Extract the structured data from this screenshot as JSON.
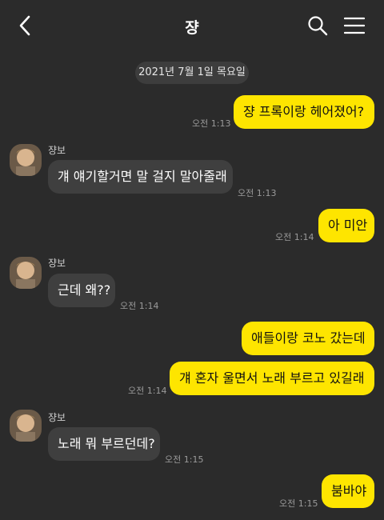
{
  "header": {
    "title": "쟝"
  },
  "date_divider": "2021년 7월 1일 목요일",
  "sender_name": "쟝보",
  "messages": [
    {
      "from": "me",
      "text": "쟝 프록이랑 헤어졌어?",
      "time": "오전 1:13"
    },
    {
      "from": "them",
      "text": "걔 얘기할거면 말 걸지 말아줄래",
      "time": "오전 1:13"
    },
    {
      "from": "me",
      "text": "아 미안",
      "time": "오전 1:14"
    },
    {
      "from": "them",
      "text": "근데 왜??",
      "time": "오전 1:14"
    },
    {
      "from": "me",
      "text": "애들이랑 코노 갔는데",
      "time": ""
    },
    {
      "from": "me",
      "text": "걔 혼자 울면서 노래 부르고 있길래",
      "time": "오전 1:14"
    },
    {
      "from": "them",
      "text": "노래 뭐 부르던데?",
      "time": "오전 1:15"
    },
    {
      "from": "me",
      "text": "붐바야",
      "time": "오전 1:15"
    }
  ],
  "colors": {
    "background": "#2b2b2b",
    "my_bubble": "#fee500",
    "their_bubble": "#3f3f3f"
  },
  "icons": [
    "back-chevron-icon",
    "search-icon",
    "hamburger-menu-icon",
    "avatar"
  ]
}
